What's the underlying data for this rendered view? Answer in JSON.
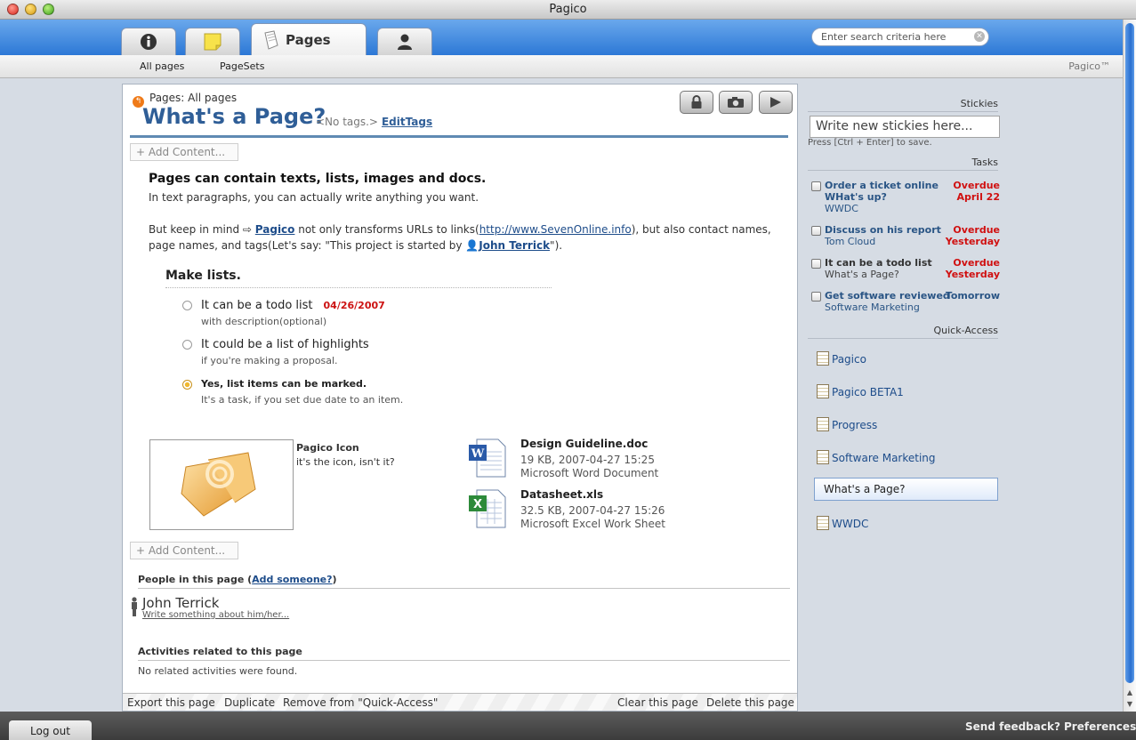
{
  "window": {
    "title": "Pagico"
  },
  "header": {
    "tabs": [
      {
        "icon": "info-icon"
      },
      {
        "icon": "sticky-note-icon"
      },
      {
        "icon": "page-icon",
        "label": "Pages",
        "active": true
      },
      {
        "icon": "person-icon"
      }
    ],
    "search": {
      "placeholder": "Enter search criteria here"
    }
  },
  "subnav": {
    "items": [
      "All pages",
      "PageSets"
    ],
    "brand": "Pagico™"
  },
  "page": {
    "breadcrumb": "Pages: All pages",
    "title": "What's a Page?",
    "no_tags": "<No tags.>",
    "edit_tags": "EditTags",
    "add_content": "+ Add Content...",
    "heading": "Pages can contain texts, lists, images and docs.",
    "intro": "In text paragraphs, you can actually write anything you want.",
    "para": {
      "p1": "But keep in mind ",
      "link1": "Pagico",
      "p2": " not only transforms URLs to links(",
      "url": "http://www.SevenOnline.info",
      "p3": "), but also contact names,",
      "p4": "page names, and tags(Let's say: \"This project is started by ",
      "person": "John Terrick",
      "p5": "\")."
    },
    "list": {
      "title": "Make lists.",
      "items": [
        {
          "text": "It can be a todo list",
          "date": "04/26/2007",
          "desc": "with description(optional)",
          "marked": false
        },
        {
          "text": "It could be a list of highlights",
          "date": "",
          "desc": "if you're making a proposal.",
          "marked": false
        },
        {
          "text": "Yes, list items can be marked.",
          "date": "",
          "desc": "It's a task, if you set due date to an item.",
          "marked": true
        }
      ]
    },
    "image": {
      "title": "Pagico Icon",
      "caption": "it's the icon, isn't it?"
    },
    "files": [
      {
        "name": "Design Guideline.doc",
        "meta": "19 KB, 2007-04-27 15:25",
        "type": "Microsoft Word Document",
        "icon": "word-document-icon"
      },
      {
        "name": "Datasheet.xls",
        "meta": "32.5 KB, 2007-04-27 15:26",
        "type": "Microsoft Excel Work Sheet",
        "icon": "excel-sheet-icon"
      }
    ],
    "people": {
      "heading": "People in this page (",
      "add": "Add someone?",
      "close": ")",
      "name": "John Terrick",
      "write": "Write something about him/her..."
    },
    "activities": {
      "heading": "Activities related to this page",
      "empty": "No related activities were found."
    },
    "footer": {
      "export": "Export this page",
      "duplicate": "Duplicate",
      "remove": "Remove from \"Quick-Access\"",
      "clear": "Clear this page",
      "delete": "Delete this page"
    }
  },
  "sidebar": {
    "stickies": {
      "heading": "Stickies",
      "placeholder": "Write new stickies here...",
      "hint": "Press [Ctrl + Enter] to save."
    },
    "tasks": {
      "heading": "Tasks",
      "items": [
        {
          "title": "Order a ticket online",
          "sub": "WHat's up?",
          "sub2": "WWDC",
          "status": "Overdue",
          "status2": "April 22",
          "sub_bold": true
        },
        {
          "title": "Discuss on his report",
          "sub": "Tom Cloud",
          "status": "Overdue",
          "status2": "Yesterday"
        },
        {
          "title": "It can be a todo list",
          "sub": "What's a Page?",
          "status": "Overdue",
          "status2": "Yesterday"
        },
        {
          "title": "Get software reviewed",
          "sub": "Software Marketing",
          "status": "Tomorrow",
          "status2": ""
        }
      ]
    },
    "quick_access": {
      "heading": "Quick-Access",
      "items": [
        "Pagico",
        "Pagico BETA1",
        "Progress",
        "Software Marketing",
        "What's a Page?",
        "WWDC"
      ],
      "selected": "What's a Page?"
    }
  },
  "bottom": {
    "logout": "Log out",
    "feedback": "Send feedback?",
    "preferences": "Preferences"
  },
  "colors": {
    "header_blue": "#2c78d6",
    "title_blue": "#2f5e97",
    "overdue_red": "#d01010"
  }
}
